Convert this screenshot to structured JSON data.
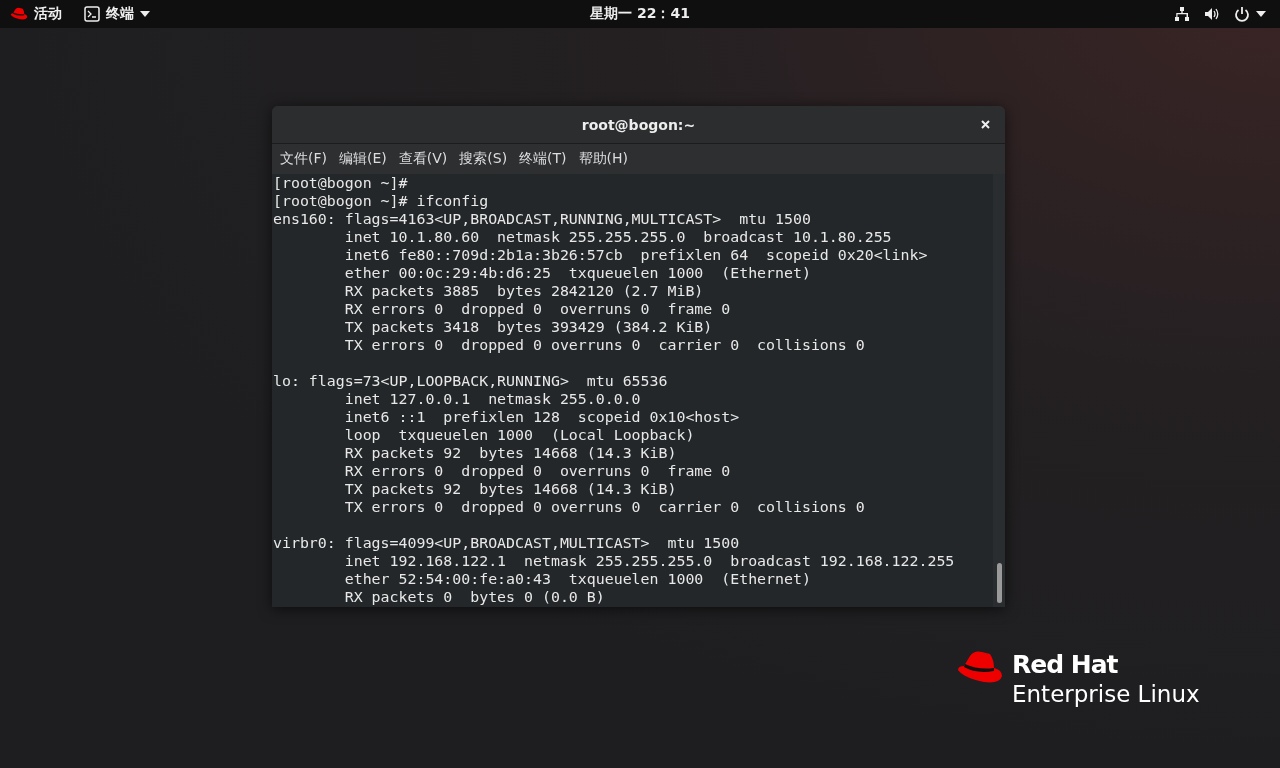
{
  "top_bar": {
    "activities": "活动",
    "app_menu": "终端",
    "clock": "星期一 22：41"
  },
  "window": {
    "title": "root@bogon:~",
    "menu": [
      "文件(F)",
      "编辑(E)",
      "查看(V)",
      "搜索(S)",
      "终端(T)",
      "帮助(H)"
    ],
    "blocks": [
      [
        "[root@bogon ~]#",
        "[root@bogon ~]# ifconfig",
        "ens160: flags=4163<UP,BROADCAST,RUNNING,MULTICAST>  mtu 1500",
        "        inet 10.1.80.60  netmask 255.255.255.0  broadcast 10.1.80.255",
        "        inet6 fe80::709d:2b1a:3b26:57cb  prefixlen 64  scopeid 0x20<link>",
        "        ether 00:0c:29:4b:d6:25  txqueuelen 1000  (Ethernet)",
        "        RX packets 3885  bytes 2842120 (2.7 MiB)",
        "        RX errors 0  dropped 0  overruns 0  frame 0",
        "        TX packets 3418  bytes 393429 (384.2 KiB)",
        "        TX errors 0  dropped 0 overruns 0  carrier 0  collisions 0"
      ],
      [
        "lo: flags=73<UP,LOOPBACK,RUNNING>  mtu 65536",
        "        inet 127.0.0.1  netmask 255.0.0.0",
        "        inet6 ::1  prefixlen 128  scopeid 0x10<host>",
        "        loop  txqueuelen 1000  (Local Loopback)",
        "        RX packets 92  bytes 14668 (14.3 KiB)",
        "        RX errors 0  dropped 0  overruns 0  frame 0",
        "        TX packets 92  bytes 14668 (14.3 KiB)",
        "        TX errors 0  dropped 0 overruns 0  carrier 0  collisions 0"
      ],
      [
        "virbr0: flags=4099<UP,BROADCAST,MULTICAST>  mtu 1500",
        "        inet 192.168.122.1  netmask 255.255.255.0  broadcast 192.168.122.255",
        "        ether 52:54:00:fe:a0:43  txqueuelen 1000  (Ethernet)",
        "        RX packets 0  bytes 0 (0.0 B)"
      ]
    ]
  },
  "logo": {
    "brand": "Red Hat",
    "product": "Enterprise Linux"
  }
}
